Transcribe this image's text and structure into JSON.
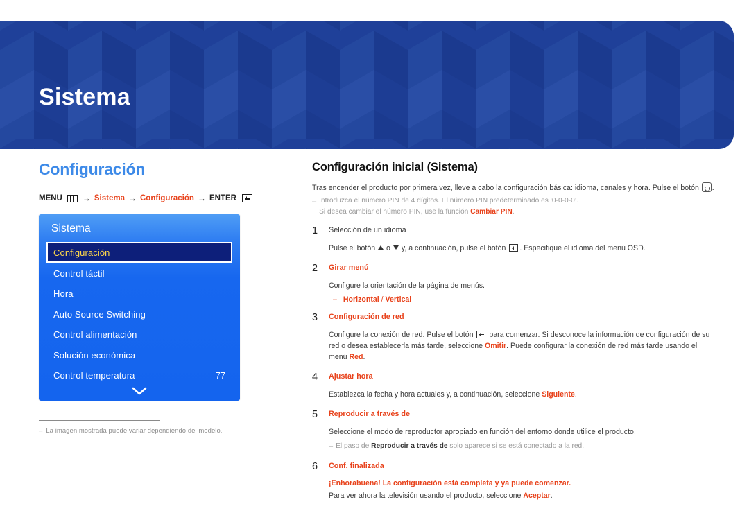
{
  "banner": {
    "title": "Sistema"
  },
  "left": {
    "section_title": "Configuración",
    "breadcrumb": {
      "menu_label": "MENU",
      "menu_icon": "menu-bars-icon",
      "arrow": "→",
      "item1": "Sistema",
      "item2": "Configuración",
      "enter_label": "ENTER",
      "enter_icon": "enter-key-icon"
    },
    "osd": {
      "header": "Sistema",
      "items": [
        {
          "label": "Configuración",
          "value": "",
          "selected": true
        },
        {
          "label": "Control táctil",
          "value": "",
          "selected": false
        },
        {
          "label": "Hora",
          "value": "",
          "selected": false
        },
        {
          "label": "Auto Source Switching",
          "value": "",
          "selected": false
        },
        {
          "label": "Control alimentación",
          "value": "",
          "selected": false
        },
        {
          "label": "Solución económica",
          "value": "",
          "selected": false
        },
        {
          "label": "Control temperatura",
          "value": "77",
          "selected": false
        }
      ],
      "scroll_icon": "chevron-down-icon"
    },
    "footnote": {
      "dash": "‒",
      "text": "La imagen mostrada puede variar dependiendo del modelo."
    }
  },
  "right": {
    "title": "Configuración inicial (Sistema)",
    "lead_a": "Tras encender el producto por primera vez, lleve a cabo la configuración básica: idioma, canales y hora.  Pulse el botón ",
    "lead_power_icon": "power-button-icon",
    "lead_b": ".",
    "pin_note_dash": "‒",
    "pin_note_line1": "Introduzca el número PIN de 4 dígitos. El número PIN predeterminado es ‘0-0-0-0’.",
    "pin_note_line2_a": "Si desea cambiar el número PIN, use la función ",
    "pin_note_line2_b": "Cambiar PIN",
    "pin_note_line2_c": ".",
    "steps": [
      {
        "num": "1",
        "head": "Selección de un idioma",
        "head_red": false,
        "para_a": "Pulse el botón ",
        "para_icon_up": "triangle-up-icon",
        "para_mid": " o ",
        "para_icon_dn": "triangle-down-icon",
        "para_b": " y, a continuación, pulse el botón ",
        "para_icon_enter": "enter-key-icon",
        "para_c": ". Especifique el idioma del menú OSD."
      },
      {
        "num": "2",
        "head": "Girar menú",
        "head_red": true,
        "para": "Configure la orientación de la página de menús.",
        "bullet_dash": "‒",
        "bullet_a": "Horizontal",
        "bullet_slash": " / ",
        "bullet_b": "Vertical"
      },
      {
        "num": "3",
        "head": "Configuración de red",
        "head_red": true,
        "para_a": "Configure la conexión de red. Pulse el botón ",
        "para_icon_enter": "enter-key-icon",
        "para_b": " para comenzar. Si desconoce la información de configuración de su red o desea establecerla más tarde, seleccione ",
        "para_bold1": "Omitir",
        "para_c": ". Puede configurar la conexión de red más tarde usando el menú ",
        "para_bold2": "Red",
        "para_d": "."
      },
      {
        "num": "4",
        "head": "Ajustar hora",
        "head_red": true,
        "para_a": "Establezca la fecha y hora actuales y, a continuación, seleccione ",
        "para_bold1": "Siguiente",
        "para_b": "."
      },
      {
        "num": "5",
        "head": "Reproducir a través de",
        "head_red": true,
        "para": "Seleccione el modo de reproductor apropiado en función del entorno donde utilice el producto.",
        "note_dash": "‒",
        "note_a": "El paso de ",
        "note_bold": "Reproducir a través de",
        "note_b": " solo aparece si se está conectado a la red."
      },
      {
        "num": "6",
        "head": "Conf. finalizada",
        "head_red": true,
        "congrats": "¡Enhorabuena! La configuración está completa y ya puede comenzar.",
        "closing_a": "Para ver ahora la televisión usando el producto, seleccione ",
        "closing_bold": "Aceptar",
        "closing_b": "."
      }
    ]
  },
  "colors": {
    "banner_blue": "#1f4099",
    "accent_blue": "#3d8ae8",
    "accent_red": "#e8421b",
    "osd_blue": "#1464ee",
    "osd_selected_bg": "#0d1f7a",
    "osd_selected_text": "#ffd84a"
  }
}
